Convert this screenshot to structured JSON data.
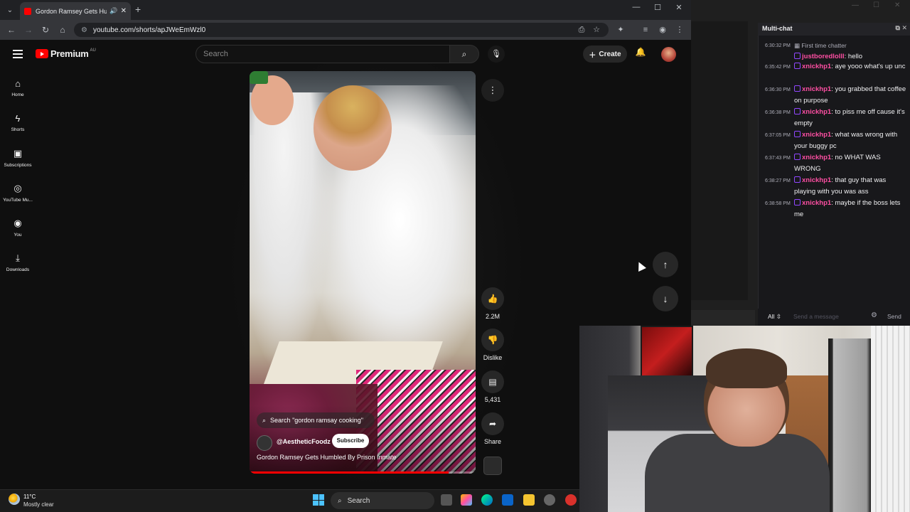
{
  "browser": {
    "tab_title": "Gordon Ramsey Gets Humbl",
    "url": "youtube.com/shorts/apJWeEmWzl0"
  },
  "youtube": {
    "logo_text": "Premium",
    "logo_region": "AU",
    "search_placeholder": "Search",
    "create_label": "Create",
    "sidebar": [
      {
        "label": "Home",
        "icon": "home-icon"
      },
      {
        "label": "Shorts",
        "icon": "shorts-icon"
      },
      {
        "label": "Subscriptions",
        "icon": "subscriptions-icon"
      },
      {
        "label": "YouTube Mu...",
        "icon": "youtube-music-icon"
      },
      {
        "label": "You",
        "icon": "you-icon"
      },
      {
        "label": "Downloads",
        "icon": "downloads-icon"
      }
    ],
    "video": {
      "search_suggestion": "Search \"gordon ramsay cooking\"",
      "channel": "@AestheticFoodz",
      "subscribe_label": "Subscribe",
      "title": "Gordon Ramsey Gets Humbled By Prison Inmate",
      "progress": 0.88
    },
    "actions": {
      "likes": "2.2M",
      "dislike_label": "Dislike",
      "comments": "5,431",
      "share_label": "Share"
    }
  },
  "chat": {
    "title": "Multi-chat",
    "first_time_label": "First time chatter",
    "messages": [
      {
        "time": "6:30:32 PM",
        "user": "justboredlolll",
        "text": "hello",
        "first_time": true
      },
      {
        "time": "6:35:42 PM",
        "user": "xnickhp1",
        "text": "aye yooo what's up unc"
      },
      {
        "time": "6:36:30 PM",
        "user": "xnickhp1",
        "text": "you grabbed that coffee on purpose"
      },
      {
        "time": "6:36:38 PM",
        "user": "xnickhp1",
        "text": "to piss me off cause it's empty"
      },
      {
        "time": "6:37:05 PM",
        "user": "xnickhp1",
        "text": "what was wrong with your buggy pc"
      },
      {
        "time": "6:37:43 PM",
        "user": "xnickhp1",
        "text": "no WHAT WAS WRONG"
      },
      {
        "time": "6:38:27 PM",
        "user": "xnickhp1",
        "text": "that guy that was playing with you was ass"
      },
      {
        "time": "6:38:58 PM",
        "user": "xnickhp1",
        "text": "maybe if the boss lets me"
      }
    ],
    "filter_label": "All",
    "input_placeholder": "Send a message",
    "send_label": "Send"
  },
  "taskbar": {
    "weather_temp": "11°C",
    "weather_desc": "Mostly clear",
    "search_label": "Search"
  },
  "colors": {
    "yt_red": "#ff0000",
    "username_pink": "#ff4fa3",
    "username_purple": "#b36bff"
  }
}
